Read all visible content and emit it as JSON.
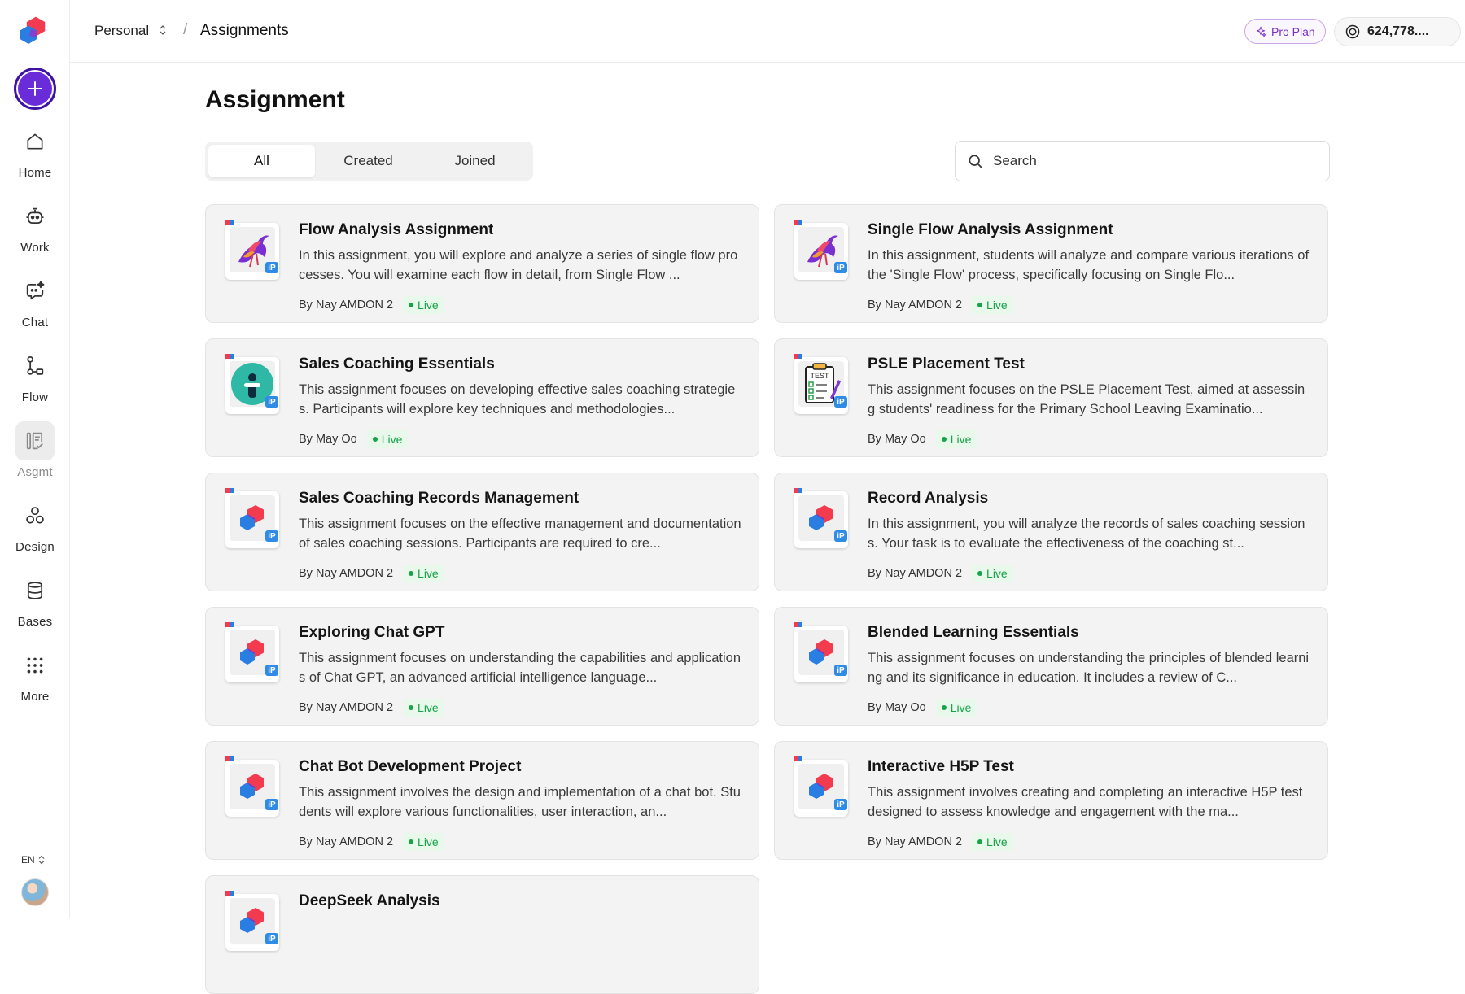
{
  "sidebar": {
    "items": [
      {
        "label": "Home",
        "icon": "home-icon"
      },
      {
        "label": "Work",
        "icon": "robot-icon"
      },
      {
        "label": "Chat",
        "icon": "chat-sparkle-icon"
      },
      {
        "label": "Flow",
        "icon": "flow-icon"
      },
      {
        "label": "Asgmt",
        "icon": "assignment-icon"
      },
      {
        "label": "Design",
        "icon": "design-icon"
      },
      {
        "label": "Bases",
        "icon": "database-icon"
      },
      {
        "label": "More",
        "icon": "grid-dots-icon"
      }
    ],
    "active": "Asgmt",
    "lang": "EN"
  },
  "header": {
    "workspace": "Personal",
    "page": "Assignments",
    "separator": "/",
    "pro_label": "Pro Plan",
    "credits": "624,778...."
  },
  "main": {
    "title": "Assignment",
    "tabs": [
      {
        "label": "All"
      },
      {
        "label": "Created"
      },
      {
        "label": "Joined"
      }
    ],
    "active_tab": "All",
    "search": {
      "placeholder": "Search",
      "value": ""
    }
  },
  "colors": {
    "accent": "#6a2bd9",
    "live_green": "#17a34a",
    "pro_purple": "#7b2ec4"
  },
  "cards": [
    {
      "title": "Flow Analysis Assignment",
      "desc": "In this assignment, you will explore and analyze a series of single flow processes. You will examine each flow in detail, from Single Flow ...",
      "author": "By Nay AMDON 2",
      "status": "Live",
      "thumb": "bird"
    },
    {
      "title": "Single Flow Analysis Assignment",
      "desc": "In this assignment, students will analyze and compare various iterations of the 'Single Flow' process, specifically focusing on Single Flo...",
      "author": "By Nay AMDON 2",
      "status": "Live",
      "thumb": "bird"
    },
    {
      "title": "Sales Coaching Essentials",
      "desc": "This assignment focuses on developing effective sales coaching strategies. Participants will explore key techniques and methodologies...",
      "author": "By May Oo",
      "status": "Live",
      "thumb": "info"
    },
    {
      "title": "PSLE Placement Test",
      "desc": "This assignment focuses on the PSLE Placement Test, aimed at assessing students' readiness for the Primary School Leaving Examinatio...",
      "author": "By May Oo",
      "status": "Live",
      "thumb": "test"
    },
    {
      "title": "Sales Coaching Records Management",
      "desc": "This assignment focuses on the effective management and documentation of sales coaching sessions. Participants are required to cre...",
      "author": "By Nay AMDON 2",
      "status": "Live",
      "thumb": "logo"
    },
    {
      "title": "Record Analysis",
      "desc": "In this assignment, you will analyze the records of sales coaching sessions. Your task is to evaluate the effectiveness of the coaching st...",
      "author": "By Nay AMDON 2",
      "status": "Live",
      "thumb": "logo"
    },
    {
      "title": "Exploring Chat GPT",
      "desc": "This assignment focuses on understanding the capabilities and applications of Chat GPT, an advanced artificial intelligence language...",
      "author": "By Nay AMDON 2",
      "status": "Live",
      "thumb": "logo"
    },
    {
      "title": "Blended Learning Essentials",
      "desc": "This assignment focuses on understanding the principles of blended learning and its significance in education. It includes a review of C...",
      "author": "By May Oo",
      "status": "Live",
      "thumb": "logo"
    },
    {
      "title": "Chat Bot Development Project",
      "desc": "This assignment involves the design and implementation of a chat bot. Students will explore various functionalities, user interaction, an...",
      "author": "By Nay AMDON 2",
      "status": "Live",
      "thumb": "logo"
    },
    {
      "title": "Interactive H5P Test",
      "desc": "This assignment involves creating and completing an interactive H5P test designed to assess knowledge and engagement with the ma...",
      "author": "By Nay AMDON 2",
      "status": "Live",
      "thumb": "logo"
    },
    {
      "title": "DeepSeek Analysis",
      "desc": "",
      "author": "",
      "status": "",
      "thumb": "logo"
    }
  ]
}
